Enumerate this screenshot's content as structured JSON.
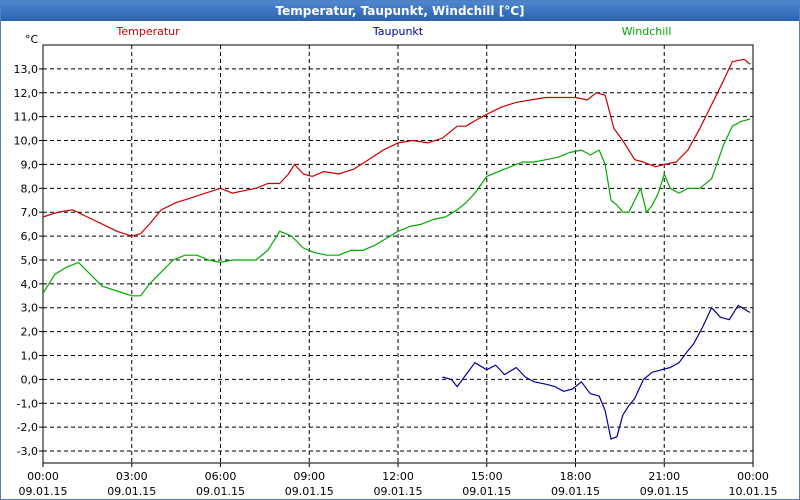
{
  "window": {
    "title": "Temperatur, Taupunkt, Windchill [°C]"
  },
  "chart_data": {
    "type": "line",
    "title": "Temperatur, Taupunkt, Windchill [°C]",
    "ylabel": "°C",
    "ylim": [
      -3.5,
      14.0
    ],
    "yticks": [
      -3,
      -2,
      -1,
      0,
      1,
      2,
      3,
      4,
      5,
      6,
      7,
      8,
      9,
      10,
      11,
      12,
      13
    ],
    "ytick_labels": [
      "-3,0",
      "-2,0",
      "-1,0",
      "0,0",
      "1,0",
      "2,0",
      "3,0",
      "4,0",
      "5,0",
      "6,0",
      "7,0",
      "8,0",
      "9,0",
      "10,0",
      "11,0",
      "12,0",
      "13,0"
    ],
    "xlim": [
      0,
      24
    ],
    "xticks": [
      0,
      3,
      6,
      9,
      12,
      15,
      18,
      21,
      24
    ],
    "xtick_time_labels": [
      "00:00",
      "03:00",
      "06:00",
      "09:00",
      "12:00",
      "15:00",
      "18:00",
      "21:00",
      "00:00"
    ],
    "xtick_date_labels": [
      "09.01.15",
      "09.01.15",
      "09.01.15",
      "09.01.15",
      "09.01.15",
      "09.01.15",
      "09.01.15",
      "09.01.15",
      "10.01.15"
    ],
    "grid": true,
    "legend_position": "top",
    "series": [
      {
        "name": "Temperatur",
        "color": "#cc0000",
        "x": [
          0,
          0.5,
          1.0,
          1.5,
          2.0,
          2.5,
          3.0,
          3.3,
          3.6,
          4.0,
          4.5,
          5.0,
          5.5,
          6.0,
          6.4,
          6.8,
          7.2,
          7.6,
          8.0,
          8.3,
          8.5,
          8.8,
          9.1,
          9.5,
          10.0,
          10.5,
          11.0,
          11.5,
          12.0,
          12.5,
          13.0,
          13.5,
          14.0,
          14.3,
          14.7,
          15.0,
          15.5,
          16.0,
          16.5,
          17.0,
          17.5,
          18.0,
          18.4,
          18.7,
          19.0,
          19.3,
          19.6,
          20.0,
          20.3,
          20.7,
          21.0,
          21.4,
          21.8,
          22.2,
          22.6,
          23.0,
          23.3,
          23.7,
          23.9
        ],
        "values": [
          6.8,
          7.0,
          7.1,
          6.8,
          6.5,
          6.2,
          6.0,
          6.1,
          6.5,
          7.1,
          7.4,
          7.6,
          7.8,
          8.0,
          7.8,
          7.9,
          8.0,
          8.2,
          8.2,
          8.6,
          9.0,
          8.6,
          8.5,
          8.7,
          8.6,
          8.8,
          9.2,
          9.6,
          9.9,
          10.0,
          9.9,
          10.1,
          10.6,
          10.6,
          10.9,
          11.1,
          11.4,
          11.6,
          11.7,
          11.8,
          11.8,
          11.8,
          11.7,
          12.0,
          11.9,
          10.5,
          10.0,
          9.2,
          9.1,
          8.9,
          9.0,
          9.1,
          9.6,
          10.5,
          11.5,
          12.5,
          13.3,
          13.4,
          13.2
        ]
      },
      {
        "name": "Taupunkt",
        "color": "#000099",
        "x": [
          13.5,
          13.8,
          14.0,
          14.3,
          14.6,
          15.0,
          15.3,
          15.6,
          16.0,
          16.3,
          16.6,
          17.0,
          17.3,
          17.6,
          17.9,
          18.2,
          18.5,
          18.8,
          19.0,
          19.2,
          19.4,
          19.6,
          19.8,
          20.0,
          20.3,
          20.6,
          20.9,
          21.2,
          21.5,
          21.8,
          22.0,
          22.3,
          22.6,
          22.9,
          23.2,
          23.5,
          23.9
        ],
        "values": [
          0.1,
          0.0,
          -0.3,
          0.2,
          0.7,
          0.4,
          0.6,
          0.2,
          0.5,
          0.1,
          -0.1,
          -0.2,
          -0.3,
          -0.5,
          -0.4,
          -0.1,
          -0.6,
          -0.7,
          -1.3,
          -2.5,
          -2.4,
          -1.5,
          -1.1,
          -0.8,
          0.0,
          0.3,
          0.4,
          0.5,
          0.7,
          1.2,
          1.5,
          2.2,
          3.0,
          2.6,
          2.5,
          3.1,
          2.8
        ]
      },
      {
        "name": "Windchill",
        "color": "#00aa00",
        "x": [
          0,
          0.4,
          0.8,
          1.2,
          1.6,
          2.0,
          2.5,
          3.0,
          3.3,
          3.6,
          4.0,
          4.4,
          4.8,
          5.2,
          5.6,
          6.0,
          6.4,
          6.8,
          7.2,
          7.6,
          8.0,
          8.4,
          8.8,
          9.2,
          9.6,
          10.0,
          10.4,
          10.8,
          11.2,
          11.6,
          12.0,
          12.4,
          12.8,
          13.2,
          13.6,
          14.0,
          14.3,
          14.6,
          15.0,
          15.4,
          15.8,
          16.2,
          16.6,
          17.0,
          17.4,
          17.8,
          18.2,
          18.5,
          18.8,
          19.0,
          19.2,
          19.4,
          19.6,
          19.8,
          20.0,
          20.2,
          20.4,
          20.6,
          20.8,
          21.0,
          21.2,
          21.5,
          21.8,
          22.2,
          22.6,
          23.0,
          23.3,
          23.6,
          23.9
        ],
        "values": [
          3.6,
          4.4,
          4.7,
          4.9,
          4.4,
          3.9,
          3.7,
          3.5,
          3.5,
          4.0,
          4.5,
          5.0,
          5.2,
          5.2,
          5.0,
          4.9,
          5.0,
          5.0,
          5.0,
          5.4,
          6.2,
          6.0,
          5.5,
          5.3,
          5.2,
          5.2,
          5.4,
          5.4,
          5.6,
          5.9,
          6.2,
          6.4,
          6.5,
          6.7,
          6.8,
          7.1,
          7.4,
          7.8,
          8.5,
          8.7,
          8.9,
          9.1,
          9.1,
          9.2,
          9.3,
          9.5,
          9.6,
          9.4,
          9.6,
          9.0,
          7.5,
          7.3,
          7.0,
          7.0,
          7.5,
          8.0,
          7.0,
          7.3,
          7.8,
          8.6,
          8.0,
          7.8,
          8.0,
          8.0,
          8.4,
          9.8,
          10.6,
          10.8,
          10.9
        ]
      }
    ]
  }
}
